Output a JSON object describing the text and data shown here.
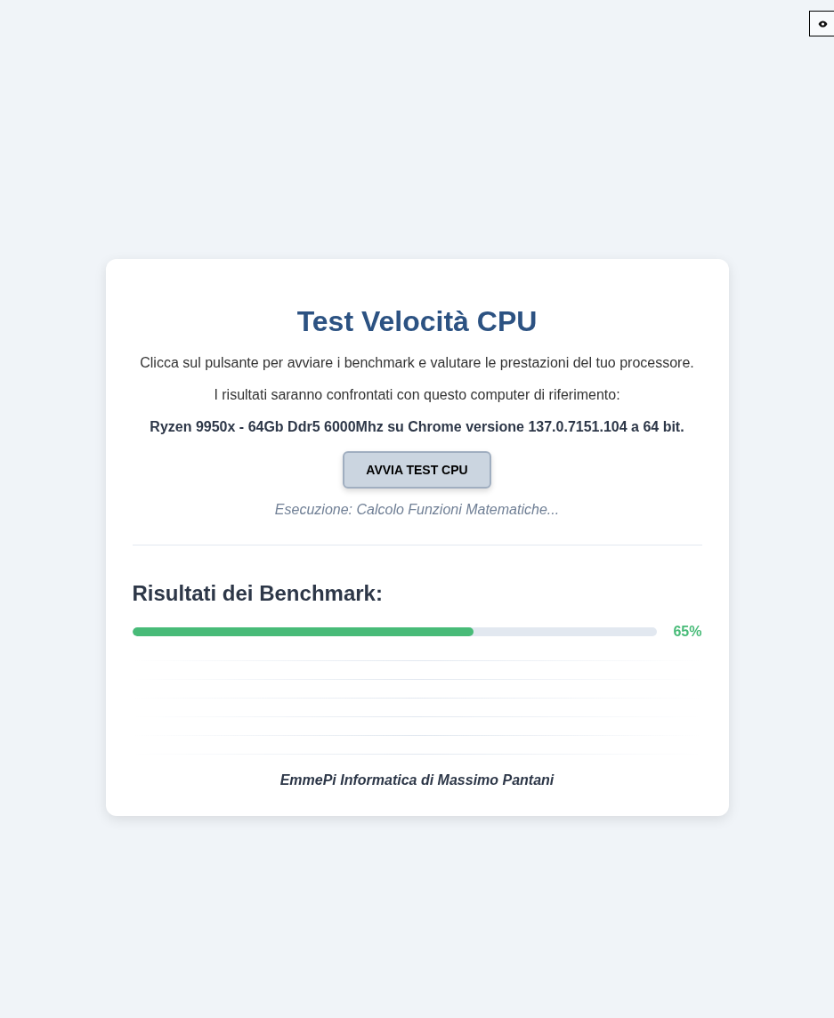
{
  "corner_button": {
    "kind": "eye"
  },
  "card": {
    "title": "Test Velocità CPU",
    "intro": "Clicca sul pulsante per avviare i benchmark e valutare le prestazioni del tuo processore.",
    "reference_note": "I risultati saranno confrontati con questo computer di riferimento:",
    "reference_machine": "Ryzen 9950x - 64Gb Ddr5 6000Mhz su Chrome versione 137.0.7151.104 a 64 bit.",
    "start_button": "AVVIA TEST CPU",
    "status": "Esecuzione: Calcolo Funzioni Matematiche...",
    "results_heading": "Risultati dei Benchmark:",
    "progress": {
      "level": 0.65,
      "reading": "65%"
    },
    "footer": "EmmePi Informatica di Massimo Pantani"
  }
}
